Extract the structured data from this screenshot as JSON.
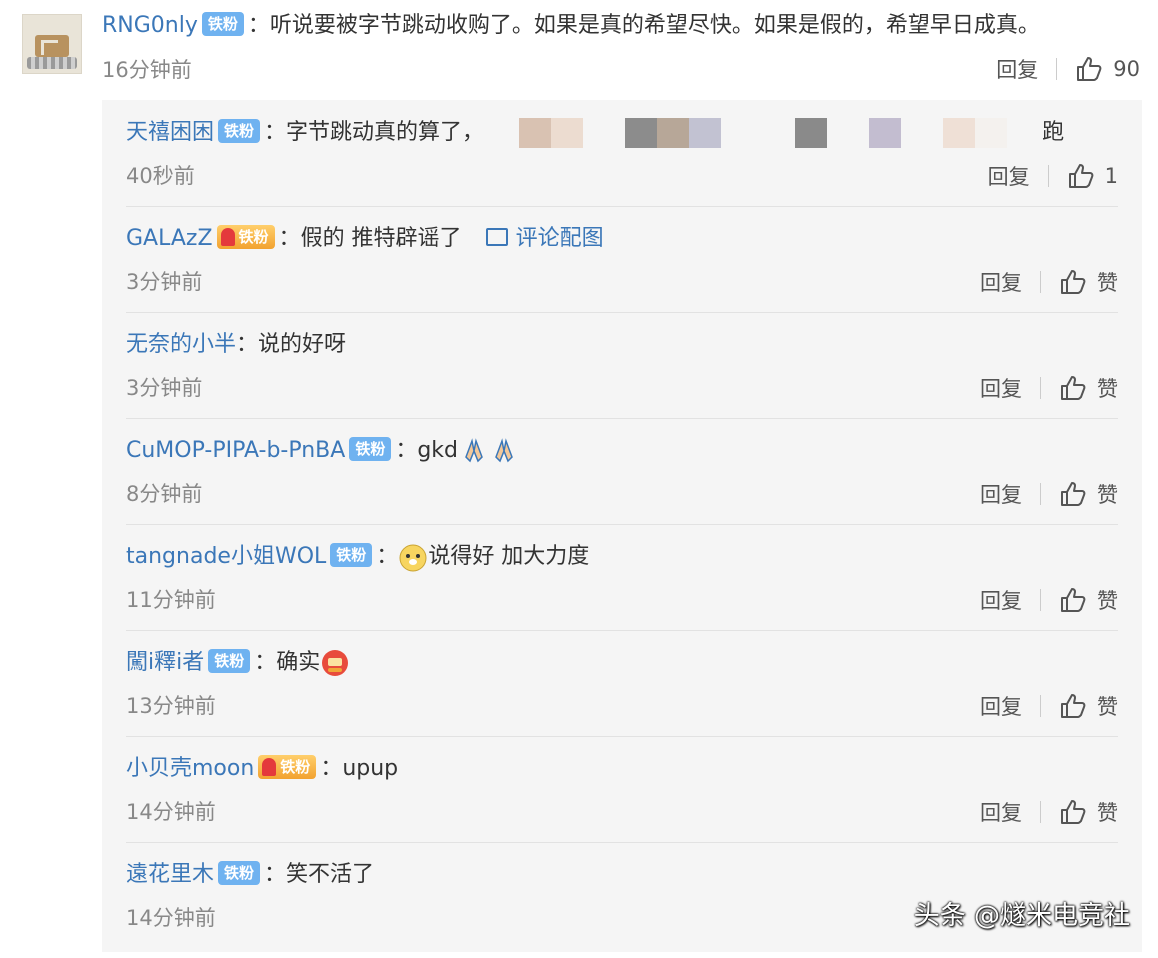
{
  "main_comment": {
    "user": "RNG0nly",
    "badge": "铁粉",
    "colon": "：",
    "text": "听说要被字节跳动收购了。如果是真的希望尽快。如果是假的，希望早日成真。",
    "time": "16分钟前",
    "reply_label": "回复",
    "like_count": "90"
  },
  "replies": [
    {
      "user": "天禧困困",
      "badge": "铁粉",
      "colon": "：",
      "text": "字节跳动真的算了，",
      "tail": "跑",
      "time": "40秒前",
      "reply_label": "回复",
      "like_label": "1"
    },
    {
      "user": "GALAzZ",
      "badge": "铁粉",
      "colon": "：",
      "text": "假的 推特辟谣了",
      "link": "评论配图",
      "time": "3分钟前",
      "reply_label": "回复",
      "like_label": "赞"
    },
    {
      "user": "无奈的小半",
      "colon": "：",
      "text": "说的好呀",
      "time": "3分钟前",
      "reply_label": "回复",
      "like_label": "赞"
    },
    {
      "user": "CuMOP-PIPA-b-PnBA",
      "badge": "铁粉",
      "colon": "：",
      "text": "gkd",
      "time": "8分钟前",
      "reply_label": "回复",
      "like_label": "赞"
    },
    {
      "user": "tangnade小姐WOL",
      "badge": "铁粉",
      "colon": "：",
      "text": "说得好 加大力度",
      "time": "11分钟前",
      "reply_label": "回复",
      "like_label": "赞"
    },
    {
      "user": "闖i釋i者",
      "badge": "铁粉",
      "colon": "：",
      "text": "确实",
      "time": "13分钟前",
      "reply_label": "回复",
      "like_label": "赞"
    },
    {
      "user": "小贝壳moon",
      "badge": "铁粉",
      "colon": "：",
      "text": "upup",
      "time": "14分钟前",
      "reply_label": "回复",
      "like_label": "赞"
    },
    {
      "user": "遠花里木",
      "badge": "铁粉",
      "colon": "：",
      "text": "笑不活了",
      "time": "14分钟前"
    }
  ],
  "watermark": "头条 @燧米电竞社",
  "colors": {
    "username": "#3b77b8",
    "badge_blue": "#6fb2f0",
    "panel_bg": "#f5f5f5"
  }
}
